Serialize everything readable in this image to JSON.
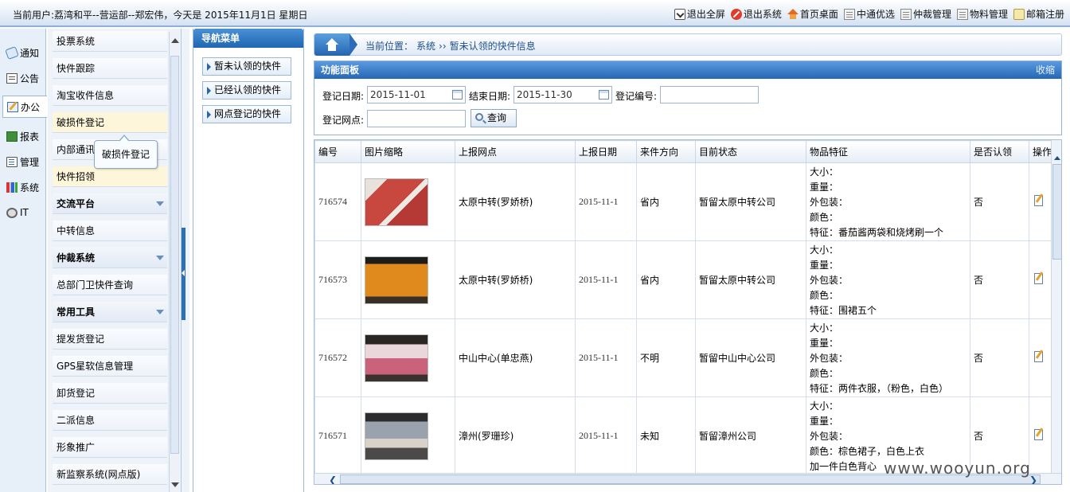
{
  "topbar": {
    "user_info": "当前用户:荔湾和平--营运部--郑宏伟，今天是 2015年11月1日 星期日",
    "links": [
      {
        "label": "退出全屏",
        "icon": "exit-fullscreen-icon"
      },
      {
        "label": "退出系统",
        "icon": "logout-icon"
      },
      {
        "label": "首页桌面",
        "icon": "home-icon"
      },
      {
        "label": "中通优选",
        "icon": "document-icon"
      },
      {
        "label": "仲裁管理",
        "icon": "document-icon"
      },
      {
        "label": "物料管理",
        "icon": "document-icon"
      },
      {
        "label": "邮箱注册",
        "icon": "mail-icon"
      }
    ]
  },
  "modules": [
    {
      "label": "通知",
      "icon": "pin-icon"
    },
    {
      "label": "公告",
      "icon": "board-icon"
    },
    {
      "label": "办公",
      "icon": "office-icon",
      "active": true
    },
    {
      "label": "报表",
      "icon": "report-icon"
    },
    {
      "label": "管理",
      "icon": "manage-icon"
    },
    {
      "label": "系统",
      "icon": "chart-icon"
    },
    {
      "label": "IT",
      "icon": "it-icon"
    }
  ],
  "sidebar": {
    "items": [
      {
        "label": "投票系统"
      },
      {
        "label": "快件跟踪"
      },
      {
        "label": "淘宝收件信息"
      },
      {
        "label": "破损件登记",
        "hover": true
      },
      {
        "label": "内部通讯"
      },
      {
        "label": "快件招领",
        "hover": true
      },
      {
        "label": "交流平台",
        "group": true
      },
      {
        "label": "中转信息"
      },
      {
        "label": "仲裁系统",
        "group": true
      },
      {
        "label": "总部门卫快件查询"
      },
      {
        "label": "常用工具",
        "group": true
      },
      {
        "label": "提发货登记"
      },
      {
        "label": "GPS星软信息管理"
      },
      {
        "label": "卸货登记"
      },
      {
        "label": "二派信息"
      },
      {
        "label": "形象推广"
      },
      {
        "label": "新监察系统(网点版)"
      }
    ],
    "tooltip": "破损件登记"
  },
  "nav_menu": {
    "title": "导航菜单",
    "items": [
      {
        "label": "暂未认领的快件"
      },
      {
        "label": "已经认领的快件"
      },
      {
        "label": "网点登记的快件"
      }
    ]
  },
  "breadcrumb": {
    "prefix": "当前位置：",
    "path1": "系统",
    "separator": "››",
    "path2": "暂未认领的快件信息"
  },
  "func_panel": {
    "title": "功能面板",
    "collapse_label": "收缩",
    "start_label": "登记日期:",
    "start_value": "2015-11-01",
    "end_label": "结束日期:",
    "end_value": "2015-11-30",
    "number_label": "登记编号:",
    "number_value": "",
    "branch_label": "登记网点:",
    "branch_value": "",
    "query_label": "查询"
  },
  "grid": {
    "headers": [
      "编号",
      "图片缩略",
      "上报网点",
      "上报日期",
      "来件方向",
      "目前状态",
      "物品特征",
      "是否认领",
      "操作"
    ],
    "feature_labels": {
      "size": "大小：",
      "weight": "重量：",
      "package": "外包装：",
      "color": "颜色："
    },
    "rows": [
      {
        "id": "716574",
        "thumb_color": "#c8473f",
        "branch": "太原中转(罗娇桥)",
        "date": "2015-11-1",
        "direction": "省内",
        "status": "暂留太原中转公司",
        "color_value": "",
        "feature": "特征：番茄酱两袋和烧烤刷一个",
        "claimed": "否"
      },
      {
        "id": "716573",
        "thumb_color": "#e08a1e",
        "branch": "太原中转(罗娇桥)",
        "date": "2015-11-1",
        "direction": "省内",
        "status": "暂留太原中转公司",
        "color_value": "",
        "feature": "特征：围裙五个",
        "claimed": "否"
      },
      {
        "id": "716572",
        "thumb_color": "#c9627a",
        "branch": "中山中心(单忠燕)",
        "date": "2015-11-1",
        "direction": "不明",
        "status": "暂留中山中心公司",
        "color_value": "",
        "feature": "特征：两件衣服，（粉色，白色）",
        "claimed": "否"
      },
      {
        "id": "716571",
        "thumb_color": "#9aa3ad",
        "branch": "漳州(罗珊珍)",
        "date": "2015-11-1",
        "direction": "未知",
        "status": "暂留漳州公司",
        "color_value": "棕色裙子，白色上衣",
        "feature": "加一件白色背心",
        "claimed": "否"
      }
    ]
  },
  "watermark": "www.wooyun.org"
}
